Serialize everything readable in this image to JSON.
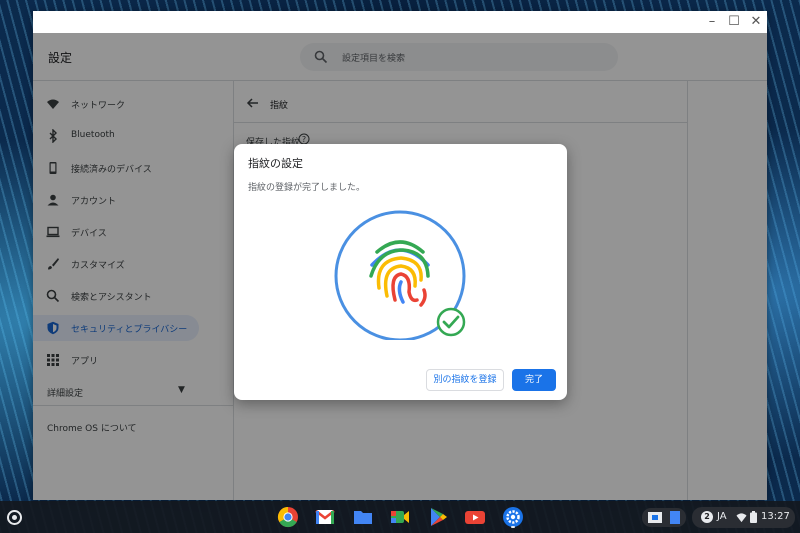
{
  "window": {
    "app_title": "設定",
    "search_placeholder": "設定項目を検索",
    "controls": [
      "minimize-icon",
      "maximize-icon",
      "close-icon"
    ]
  },
  "sidebar": {
    "items": [
      {
        "label": "ネットワーク",
        "icon": "wifi-icon"
      },
      {
        "label": "Bluetooth",
        "icon": "bluetooth-icon"
      },
      {
        "label": "接続済みのデバイス",
        "icon": "phone-icon"
      },
      {
        "label": "アカウント",
        "icon": "person-icon"
      },
      {
        "label": "デバイス",
        "icon": "laptop-icon"
      },
      {
        "label": "カスタマイズ",
        "icon": "brush-icon"
      },
      {
        "label": "検索とアシスタント",
        "icon": "search-icon"
      },
      {
        "label": "セキュリティとプライバシー",
        "icon": "shield-icon",
        "active": true
      },
      {
        "label": "アプリ",
        "icon": "apps-grid-icon"
      }
    ],
    "advanced_label": "詳細設定",
    "about_label": "Chrome OS について"
  },
  "content": {
    "page_title": "指紋",
    "saved_label": "保存した指紋"
  },
  "dialog": {
    "title": "指紋の設定",
    "message": "指紋の登録が完了しました。",
    "secondary_button": "別の指紋を登録",
    "primary_button": "完了"
  },
  "shelf": {
    "apps": [
      "chrome-icon",
      "gmail-icon",
      "files-icon",
      "meet-icon",
      "play-store-icon",
      "youtube-icon",
      "settings-icon"
    ],
    "notification_count": "2",
    "ime": "JA",
    "time": "13:27"
  },
  "colors": {
    "accent": "#1a73e8",
    "fingerprint_ring": "#4a90e2",
    "check_green": "#34a853"
  }
}
